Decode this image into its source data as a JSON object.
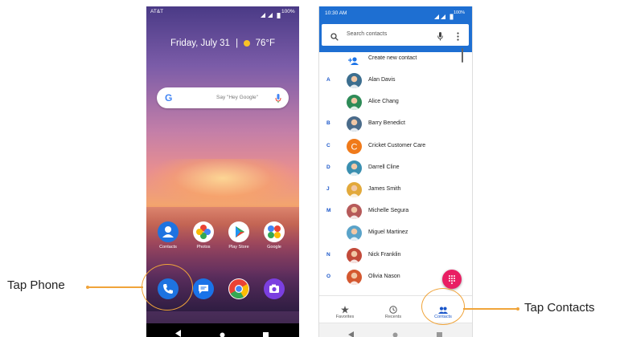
{
  "home_screen": {
    "carrier": "AT&T",
    "battery": "100%",
    "date": "Friday, July 31",
    "separator": "|",
    "temperature": "76°F",
    "search_hint": "Say \"Hey Google\"",
    "google_letter": "G",
    "apps": [
      {
        "label": "Contacts"
      },
      {
        "label": "Photos"
      },
      {
        "label": "Play Store"
      },
      {
        "label": "Google"
      }
    ],
    "dock": [
      "phone",
      "messages",
      "chrome",
      "camera"
    ]
  },
  "contacts_screen": {
    "time": "10:30 AM",
    "battery": "100%",
    "search_placeholder": "Search contacts",
    "create_label": "Create new contact",
    "contacts": [
      {
        "letter": "A",
        "name": "Alan Davis",
        "color": "#3c6e8f"
      },
      {
        "letter": "",
        "name": "Alice Chang",
        "color": "#2e8b57"
      },
      {
        "letter": "B",
        "name": "Barry Benedict",
        "color": "#4a6b8a"
      },
      {
        "letter": "C",
        "name": "Cricket Customer Care",
        "color": "#f07a1a",
        "initial": "C"
      },
      {
        "letter": "D",
        "name": "Darrell Cline",
        "color": "#3a8fb0"
      },
      {
        "letter": "J",
        "name": "James Smith",
        "color": "#e2a93b"
      },
      {
        "letter": "M",
        "name": "Michelle Segura",
        "color": "#b65a5a"
      },
      {
        "letter": "",
        "name": "Miguel Martinez",
        "color": "#5aa3c9"
      },
      {
        "letter": "N",
        "name": "Nick Franklin",
        "color": "#c24a3a"
      },
      {
        "letter": "O",
        "name": "Olivia Nason",
        "color": "#d4582f"
      }
    ],
    "tabs": [
      {
        "label": "Favorites"
      },
      {
        "label": "Recents"
      },
      {
        "label": "Contacts"
      }
    ]
  },
  "callouts": {
    "left": "Tap Phone",
    "right": "Tap Contacts"
  },
  "colors": {
    "accent": "#f0a43a",
    "contacts_blue": "#1e6fd2",
    "fab_pink": "#e91e63"
  }
}
